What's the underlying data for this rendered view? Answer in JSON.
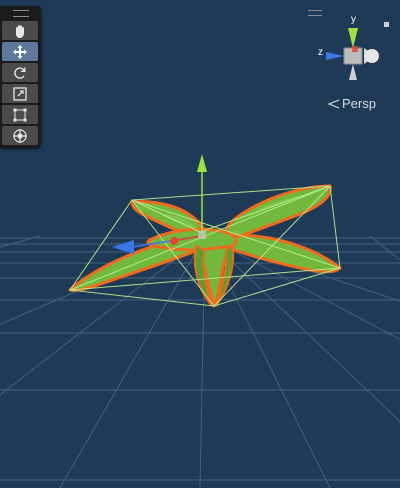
{
  "toolbar": {
    "tools": [
      {
        "name": "hand-tool",
        "active": false
      },
      {
        "name": "move-tool",
        "active": true
      },
      {
        "name": "rotate-tool",
        "active": false
      },
      {
        "name": "scale-tool",
        "active": false
      },
      {
        "name": "rect-tool",
        "active": false
      },
      {
        "name": "transform-tool",
        "active": false
      }
    ]
  },
  "orientation_gizmo": {
    "y_label": "y",
    "z_label": "z",
    "projection_label": "Persp"
  },
  "colors": {
    "background": "#1f3a57",
    "grid_line": "#6f8fae",
    "selection_outline": "#f26a1b",
    "leaf_fill": "#6fb43a",
    "bounds_wire": "#b8f090",
    "axis_y": "#9be23a",
    "axis_x": "#e8412f",
    "axis_z": "#3b78e6"
  }
}
